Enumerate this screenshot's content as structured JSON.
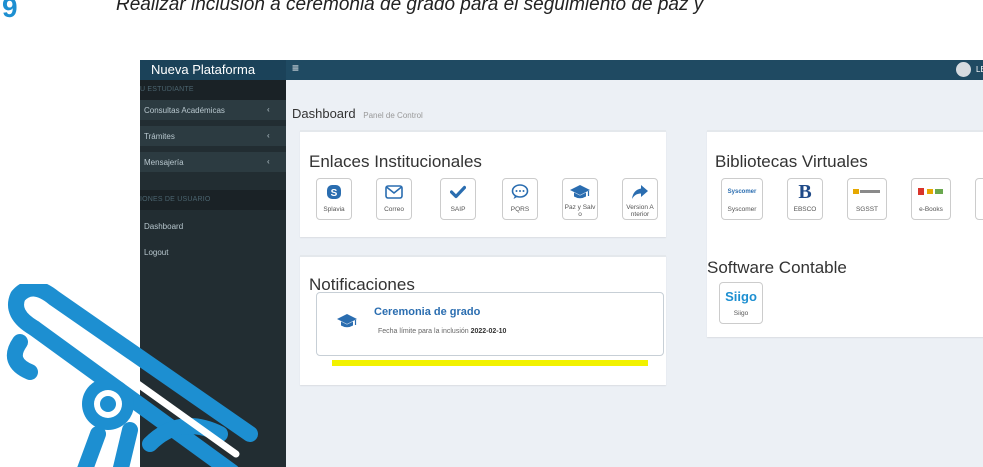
{
  "caption": {
    "step_number": "9",
    "text": "Realizar inclusión a ceremonia de grado para el seguimiento de paz y"
  },
  "topbar": {
    "brand": "Nueva Plataforma",
    "menu_icon": "hamburger-icon",
    "user_name": "LE"
  },
  "sidebar": {
    "section_student": "U ESTUDIANTE",
    "items": [
      {
        "label": "Consultas Académicas",
        "icon": "chevron-left-icon"
      },
      {
        "label": "Trámites",
        "icon": "chevron-left-icon"
      },
      {
        "label": "Mensajería",
        "icon": "chevron-left-icon"
      }
    ],
    "section_user": "IONES DE USUARIO",
    "user_items": [
      {
        "label": "Dashboard"
      },
      {
        "label": "Logout"
      }
    ],
    "chevron": "‹"
  },
  "dashboard": {
    "title": "Dashboard",
    "subtitle": "Panel de Control"
  },
  "enlaces": {
    "title": "Enlaces Institucionales",
    "tiles": [
      {
        "label": "Splavia",
        "icon": "skype-icon"
      },
      {
        "label": "Correo",
        "icon": "envelope-icon"
      },
      {
        "label": "SAIP",
        "icon": "check-icon"
      },
      {
        "label": "PQRS",
        "icon": "comment-icon"
      },
      {
        "label": "Paz y Salv o",
        "icon": "graduation-cap-icon"
      },
      {
        "label": "Version A nterior",
        "icon": "share-arrow-icon"
      }
    ]
  },
  "bibliotecas": {
    "title": "Bibliotecas Virtuales",
    "tiles": [
      {
        "label": "Syscomer",
        "logo_text": "Syscomer",
        "icon": "syscomer-logo"
      },
      {
        "label": "EBSCO",
        "logo_text": "B",
        "icon": "ebsco-logo"
      },
      {
        "label": "SGSST",
        "icon": "sgsst-logo"
      },
      {
        "label": "e-Books",
        "icon": "ebooks-logo"
      }
    ]
  },
  "software": {
    "title": "Software Contable",
    "tiles": [
      {
        "label": "Siigo",
        "logo_text": "Siigo",
        "icon": "siigo-logo"
      }
    ]
  },
  "notificaciones": {
    "title": "Notificaciones",
    "item": {
      "icon": "graduation-cap-icon",
      "title": "Ceremonia de grado",
      "text": "Fecha límite para la inclusión",
      "date": "2022-02-10"
    }
  },
  "colors": {
    "topbar": "#1f4a62",
    "sidebar": "#222d32",
    "accent": "#1d8fd1",
    "highlight": "#f2f200",
    "link": "#2a6db0"
  }
}
